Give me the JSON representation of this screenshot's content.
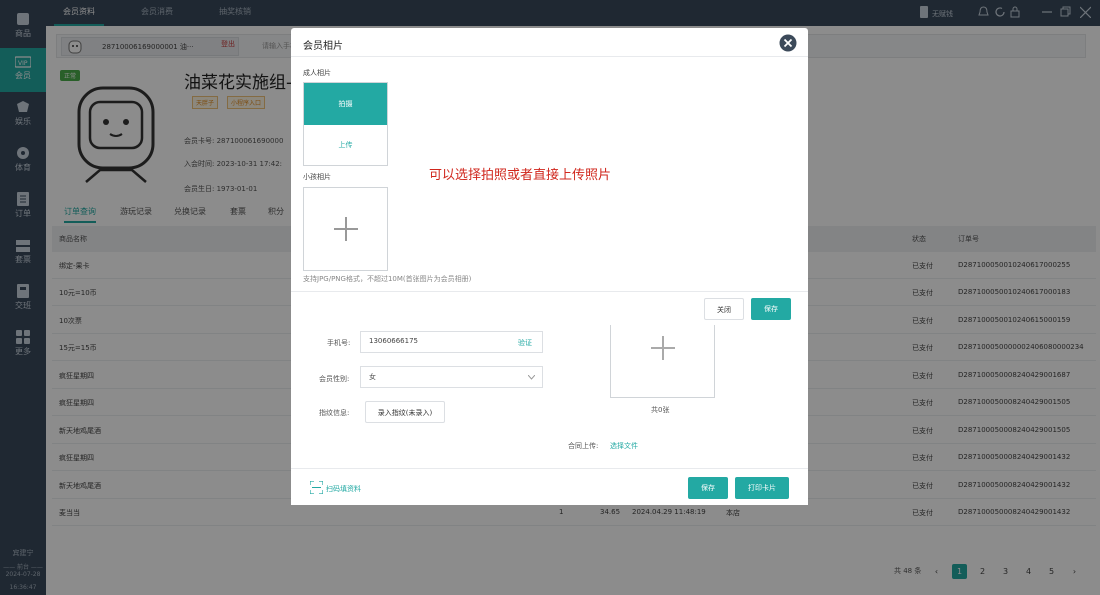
{
  "sidebar": {
    "items": [
      {
        "label": "商品",
        "icon": "goods-icon"
      },
      {
        "label": "会员",
        "icon": "vip-icon"
      },
      {
        "label": "娱乐",
        "icon": "entertainment-icon"
      },
      {
        "label": "体育",
        "icon": "sports-icon"
      },
      {
        "label": "订单",
        "icon": "order-icon"
      },
      {
        "label": "套票",
        "icon": "package-icon"
      },
      {
        "label": "交班",
        "icon": "handover-icon"
      },
      {
        "label": "更多",
        "icon": "more-icon"
      }
    ],
    "user": "宾建宁",
    "divider": "—— 前台 ——",
    "date": "2024-07-28",
    "time": "16:36:47"
  },
  "topbar": {
    "tabs": [
      "会员资料",
      "会员消费",
      "抽奖核销"
    ],
    "cashier_label": "无赋钱"
  },
  "member": {
    "card_text": "28710006169000001 油···",
    "logout": "登出",
    "search_placeholder": "请输入手机",
    "status_tag": "正常",
    "name": "油菜花实施组-黄",
    "badges": [
      "天胖子",
      "小程序入口"
    ],
    "card_no_label": "会员卡号:",
    "card_no": "287100061690000",
    "join_label": "入会时间:",
    "join_time": "2023-10-31 17:42:",
    "birthday_label": "会员生日:",
    "birthday": "1973-01-01"
  },
  "subtabs": [
    "订单查询",
    "游玩记录",
    "兑换记录",
    "套票",
    "积分"
  ],
  "table": {
    "headers": {
      "name": "商品名称",
      "status": "状态",
      "order_no": "订单号"
    },
    "rows": [
      {
        "name": "绑定-果卡",
        "status": "已支付",
        "order_no": "D287100050010240617000255"
      },
      {
        "name": "10元=10币",
        "status": "已支付",
        "order_no": "D287100050010240617000183"
      },
      {
        "name": "10次票",
        "status": "已支付",
        "order_no": "D287100050010240615000159"
      },
      {
        "name": "15元=15币",
        "status": "已支付",
        "order_no": "D287100050000002406080000234"
      },
      {
        "name": "疯狂星期四",
        "status": "已支付",
        "order_no": "D287100050008240429001687"
      },
      {
        "name": "疯狂星期四",
        "status": "已支付",
        "order_no": "D287100050008240429001505"
      },
      {
        "name": "新天地鸡尾酒",
        "status": "已支付",
        "order_no": "D287100050008240429001505"
      },
      {
        "name": "疯狂星期四",
        "status": "已支付",
        "order_no": "D287100050008240429001432"
      },
      {
        "name": "新天地鸡尾酒",
        "status": "已支付",
        "order_no": "D287100050008240429001432"
      },
      {
        "name": "麦当当",
        "qty": "1",
        "price": "34.65",
        "time": "2024.04.29 11:48:19",
        "store": "本店",
        "status": "已支付",
        "order_no": "D287100050008240429001432"
      }
    ]
  },
  "pagination": {
    "total": "共 48 条",
    "pages": [
      "1",
      "2",
      "3",
      "4",
      "5"
    ],
    "prev": "‹",
    "next": "›"
  },
  "form": {
    "phone_label": "手机号:",
    "phone_value": "13060666175",
    "verify": "验证",
    "gender_label": "会员性别:",
    "gender_value": "女",
    "fingerprint_label": "指纹信息:",
    "fingerprint_btn": "录入指纹(未录入)",
    "photo_count": "共0张",
    "contract_label": "合同上传:",
    "contract_link": "选择文件",
    "scan_link": "扫码填资料",
    "save": "保存",
    "print": "打印卡片"
  },
  "dialog": {
    "title": "会员相片",
    "adult_label": "成人相片",
    "shoot": "拍摄",
    "upload": "上传",
    "child_label": "小孩相片",
    "hint": "支持JPG/PNG格式，不超过10M(首张图片为会员相册)",
    "annotation": "可以选择拍照或者直接上传照片",
    "close": "关闭",
    "save": "保存"
  },
  "colors": {
    "accent": "#23a9a3",
    "sidebar": "#3a4a5c",
    "annotation": "#d0271d"
  }
}
